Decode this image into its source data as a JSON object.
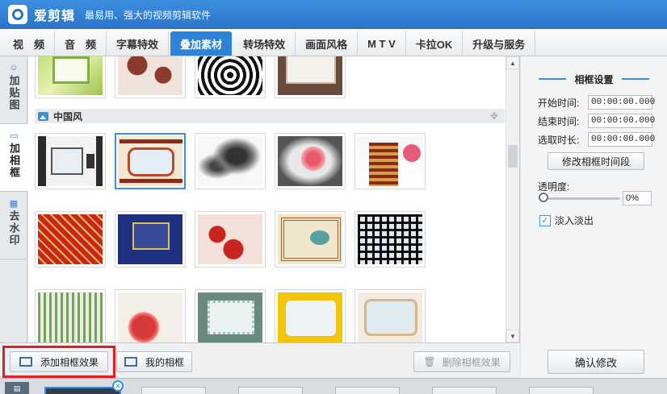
{
  "app": {
    "title": "爱剪辑",
    "slogan": "最易用、强大的视频剪辑软件"
  },
  "tabs": [
    {
      "label": "视　频"
    },
    {
      "label": "音　频"
    },
    {
      "label": "字幕特效"
    },
    {
      "label": "叠加素材",
      "active": true
    },
    {
      "label": "转场特效"
    },
    {
      "label": "画面风格"
    },
    {
      "label": "M T V"
    },
    {
      "label": "卡拉OK"
    },
    {
      "label": "升级与服务"
    }
  ],
  "side_tabs": [
    {
      "label": "加贴图",
      "icon": "sticker-icon"
    },
    {
      "label": "加相框",
      "icon": "frame-icon",
      "active": true
    },
    {
      "label": "去水印",
      "icon": "watermark-icon"
    }
  ],
  "gallery": {
    "section_title": "中国风",
    "selected_index": 1
  },
  "buttons": {
    "add_frame": "添加相框效果",
    "my_frames": "我的相框",
    "delete_frame": "删除相框效果",
    "confirm": "确认修改"
  },
  "frame_settings": {
    "title": "相框设置",
    "start_label": "开始时间:",
    "start_value": "00:00:00.000",
    "end_label": "结束时间:",
    "end_value": "00:00:00.000",
    "duration_label": "选取时长:",
    "duration_value": "00:00:00.000",
    "modify_button": "修改相框时间段",
    "opacity_label": "透明度:",
    "opacity_value": "0%",
    "opacity_level": 0,
    "fade_label": "淡入淡出",
    "fade_checked": true
  },
  "colors": {
    "accent": "#2f83d6",
    "highlight": "#e02020",
    "titlebar": "#2a74c8"
  }
}
